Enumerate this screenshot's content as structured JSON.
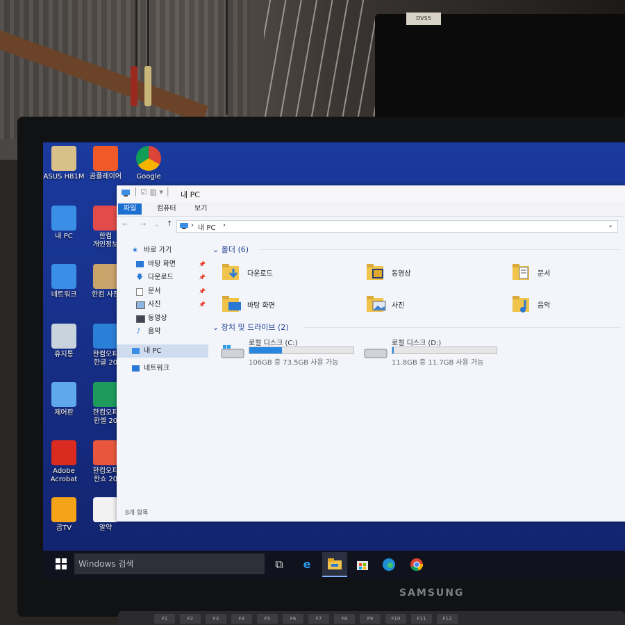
{
  "colors": {
    "desktop": "#17308a",
    "accent": "#1b6fd1",
    "bar_fill": "#2686e0"
  },
  "monitor": {
    "brand": "SAMSUNG"
  },
  "background": {
    "sticker": "DVS5"
  },
  "keyboard": {
    "keys": [
      "F1",
      "F2",
      "F3",
      "F4",
      "F5",
      "F6",
      "F7",
      "F8",
      "F9",
      "F10",
      "F11",
      "F12"
    ]
  },
  "desktop_icons": [
    {
      "label": "ASUS H81M",
      "icon": "asus-icon"
    },
    {
      "label": "곰플레이어",
      "icon": "gom-player-icon"
    },
    {
      "label": "Google",
      "icon": "chrome-icon"
    },
    {
      "label": "내 PC",
      "icon": "this-pc-icon"
    },
    {
      "label": "한컴\n개인정보",
      "icon": "hancom-privacy-icon"
    },
    {
      "label": "네트워크",
      "icon": "network-icon"
    },
    {
      "label": "한컴 사전",
      "icon": "hancom-dictionary-icon"
    },
    {
      "label": "휴지통",
      "icon": "recycle-bin-icon"
    },
    {
      "label": "한컴오피\n한글 20",
      "icon": "hancom-hangul-icon"
    },
    {
      "label": "제어판",
      "icon": "control-panel-icon"
    },
    {
      "label": "한컴오피\n한셀 20",
      "icon": "hancom-hancell-icon"
    },
    {
      "label": "Adobe\nAcrobat",
      "icon": "acrobat-icon"
    },
    {
      "label": "한컴오피\n한쇼 20",
      "icon": "hancom-hanshow-icon"
    },
    {
      "label": "곰TV",
      "icon": "gomtv-icon"
    },
    {
      "label": "알약",
      "icon": "alyac-icon"
    }
  ],
  "explorer": {
    "title": "내 PC",
    "tabs": [
      "파일",
      "컴퓨터",
      "보기"
    ],
    "address": "내 PC",
    "nav": [
      {
        "label": "바로 가기",
        "pinned": false
      },
      {
        "label": "바탕 화면",
        "pinned": true
      },
      {
        "label": "다운로드",
        "pinned": true
      },
      {
        "label": "문서",
        "pinned": true
      },
      {
        "label": "사진",
        "pinned": true
      },
      {
        "label": "동영상",
        "pinned": false
      },
      {
        "label": "음악",
        "pinned": false
      },
      {
        "label": "내 PC",
        "pinned": false
      },
      {
        "label": "네트워크",
        "pinned": false
      }
    ],
    "folders_header": "폴더 (6)",
    "folders": [
      {
        "name": "다운로드",
        "icon": "downloads-folder-icon"
      },
      {
        "name": "동영상",
        "icon": "videos-folder-icon"
      },
      {
        "name": "문서",
        "icon": "documents-folder-icon"
      },
      {
        "name": "바탕 화면",
        "icon": "desktop-folder-icon"
      },
      {
        "name": "사진",
        "icon": "pictures-folder-icon"
      },
      {
        "name": "음악",
        "icon": "music-folder-icon"
      }
    ],
    "drives_header": "장치 및 드라이브 (2)",
    "drives": [
      {
        "name": "로컬 디스크 (C:)",
        "usage": "106GB 중 73.5GB 사용 가능",
        "used_fraction": 0.31
      },
      {
        "name": "로컬 디스크 (D:)",
        "usage": "11.8GB 중 11.7GB 사용 가능",
        "used_fraction": 0.01
      }
    ],
    "status": "8개 항목"
  },
  "taskbar": {
    "search_placeholder": "Windows 검색"
  }
}
